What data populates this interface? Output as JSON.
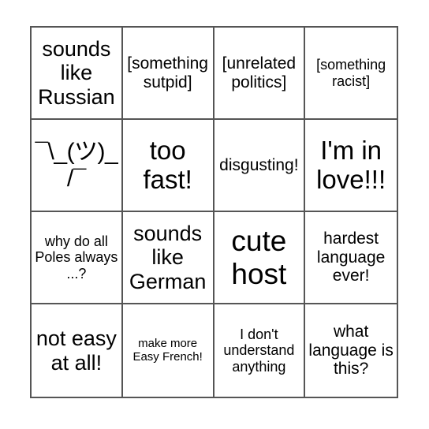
{
  "card": {
    "type": "bingo-card",
    "rows": 4,
    "columns": 4,
    "border_color": "#555555",
    "background_color": "#ffffff",
    "text_color": "#000000",
    "cells": [
      [
        {
          "text": "sounds like Russian",
          "size": "lg"
        },
        {
          "text": "[something sutpid]",
          "size": "md"
        },
        {
          "text": "[unrelated politics]",
          "size": "md"
        },
        {
          "text": "[something racist]",
          "size": "sm"
        }
      ],
      [
        {
          "text": "¯\\_(ツ)_/¯",
          "size": "kaomoji"
        },
        {
          "text": "too fast!",
          "size": "xl"
        },
        {
          "text": "disgusting!",
          "size": "md"
        },
        {
          "text": "I'm in love!!!",
          "size": "xl"
        }
      ],
      [
        {
          "text": "why do all Poles always ...?",
          "size": "sm"
        },
        {
          "text": "sounds like German",
          "size": "lg"
        },
        {
          "text": "cute host",
          "size": "xxl"
        },
        {
          "text": "hardest language ever!",
          "size": "md"
        }
      ],
      [
        {
          "text": "not easy at all!",
          "size": "lg"
        },
        {
          "text": "make more Easy French!",
          "size": "xs"
        },
        {
          "text": "I don't understand anything",
          "size": "sm"
        },
        {
          "text": "what language is this?",
          "size": "md"
        }
      ]
    ]
  }
}
